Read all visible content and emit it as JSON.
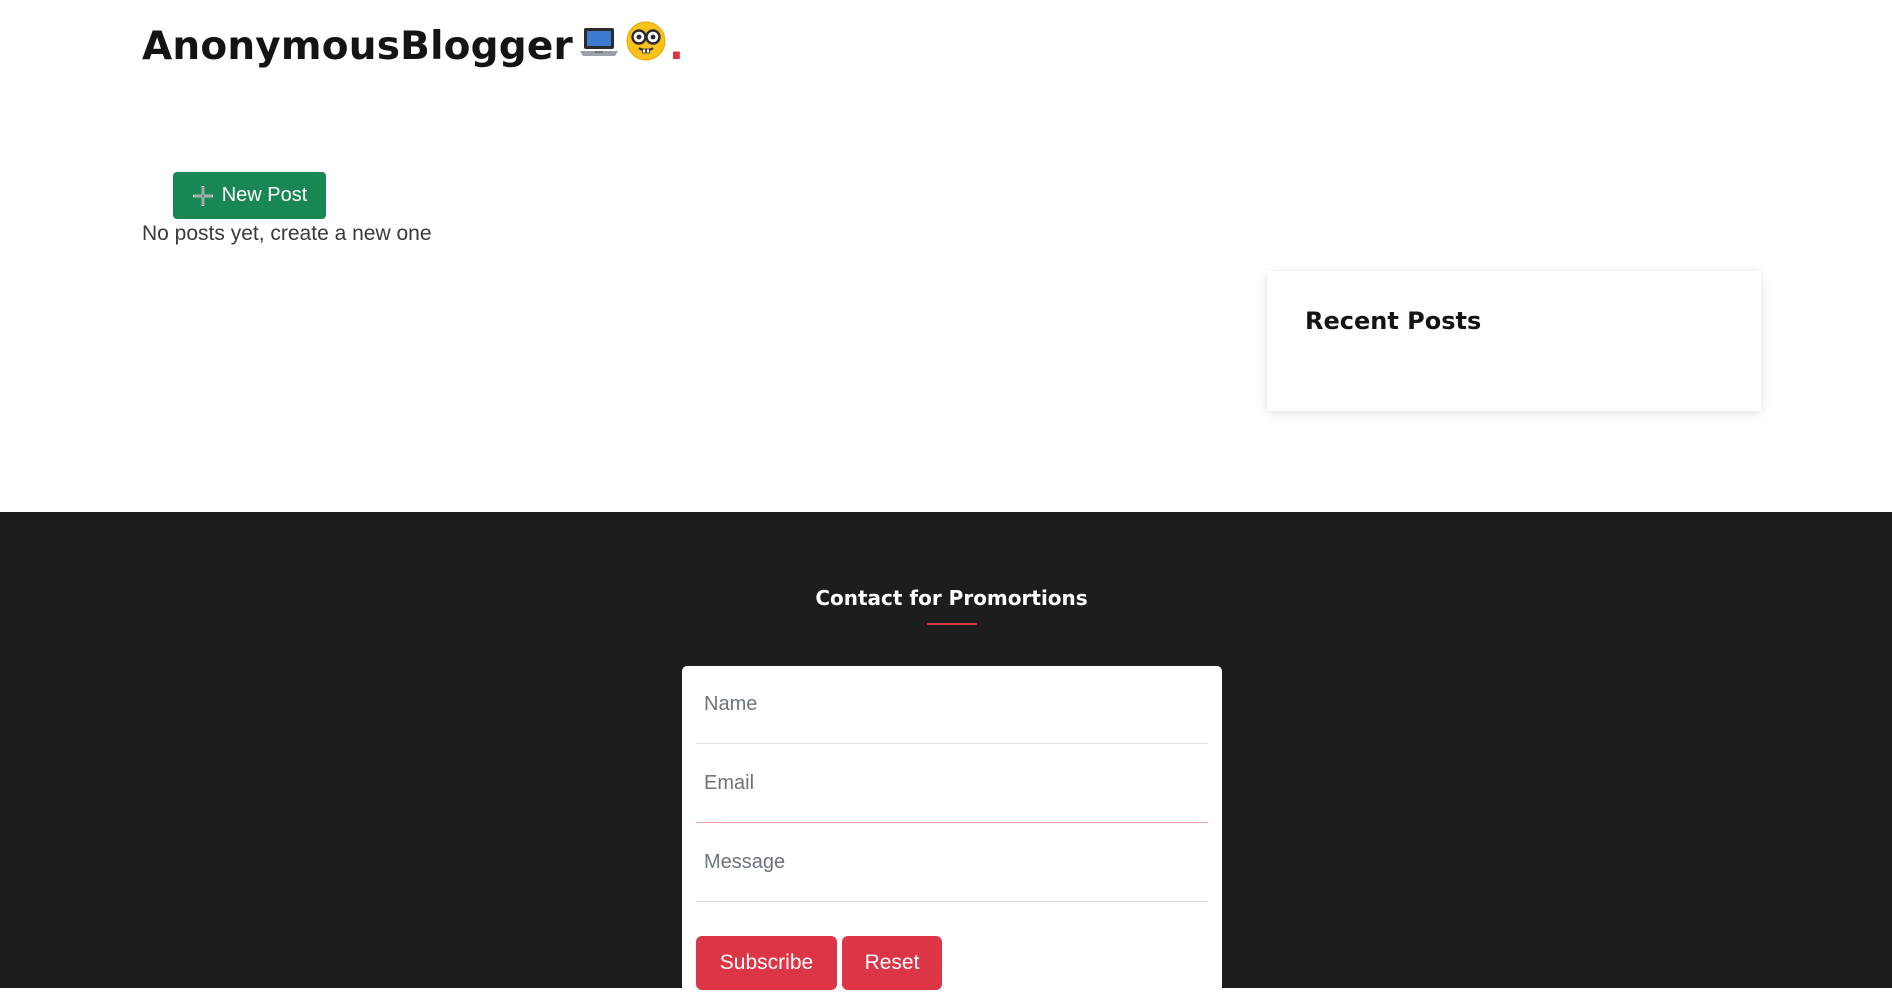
{
  "brand": {
    "name": "AnonymousBlogger",
    "dot": "."
  },
  "main": {
    "new_post_label": "New Post",
    "empty_message": "No posts yet, create a new one"
  },
  "sidebar": {
    "recent_posts_title": "Recent Posts"
  },
  "footer": {
    "contact_title": "Contact for Promortions",
    "form": {
      "name_placeholder": "Name",
      "email_placeholder": "Email",
      "message_placeholder": "Message",
      "subscribe_label": "Subscribe",
      "reset_label": "Reset"
    }
  },
  "icons": {
    "brand": [
      "laptop-icon",
      "nerd-face-icon"
    ],
    "new_post": "plus-icon"
  },
  "colors": {
    "accent_red": "#dc3545",
    "success_green": "#198754",
    "footer_bg": "#1d1d1d"
  }
}
